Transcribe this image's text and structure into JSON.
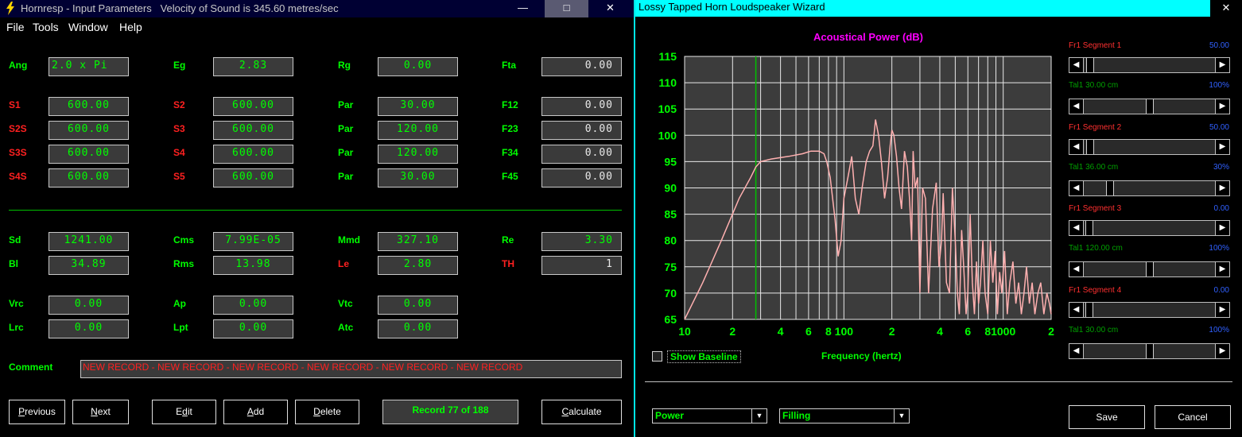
{
  "left_window": {
    "title": "Hornresp - Input Parameters   Velocity of Sound is 345.60 metres/sec",
    "controls": {
      "minimize": "—",
      "maximize": "□",
      "close": "✕"
    },
    "menu": [
      "File",
      "Tools",
      "Window",
      "Help"
    ],
    "params": {
      "Ang": "2.0 x Pi",
      "Eg": "2.83",
      "Rg": "0.00",
      "Fta": "0.00",
      "S1": "600.00",
      "S2": "600.00",
      "Par1": "30.00",
      "F12": "0.00",
      "S2S": "600.00",
      "S3": "600.00",
      "Par2": "120.00",
      "F23": "0.00",
      "S3S": "600.00",
      "S4": "600.00",
      "Par3": "120.00",
      "F34": "0.00",
      "S4S": "600.00",
      "S5": "600.00",
      "Par4": "30.00",
      "F45": "0.00",
      "Sd": "1241.00",
      "Cms": "7.99E-05",
      "Mmd": "327.10",
      "Re": "3.30",
      "Bl": "34.89",
      "Rms": "13.98",
      "Le": "2.80",
      "TH": "1",
      "Vrc": "0.00",
      "Ap": "0.00",
      "Vtc": "0.00",
      "Lrc": "0.00",
      "Lpt": "0.00",
      "Atc": "0.00"
    },
    "labels": {
      "Ang": "Ang",
      "Eg": "Eg",
      "Rg": "Rg",
      "Fta": "Fta",
      "S1": "S1",
      "S2": "S2",
      "Par": "Par",
      "F12": "F12",
      "S2S": "S2S",
      "S3": "S3",
      "F23": "F23",
      "S3S": "S3S",
      "S4": "S4",
      "F34": "F34",
      "S4S": "S4S",
      "S5": "S5",
      "F45": "F45",
      "Sd": "Sd",
      "Cms": "Cms",
      "Mmd": "Mmd",
      "Re": "Re",
      "Bl": "Bl",
      "Rms": "Rms",
      "Le": "Le",
      "TH": "TH",
      "Vrc": "Vrc",
      "Ap": "Ap",
      "Vtc": "Vtc",
      "Lrc": "Lrc",
      "Lpt": "Lpt",
      "Atc": "Atc",
      "Comment": "Comment"
    },
    "comment": "NEW RECORD - NEW RECORD - NEW RECORD - NEW RECORD - NEW RECORD - NEW RECORD",
    "buttons": {
      "previous_u": "P",
      "previous_rest": "revious",
      "next_u": "N",
      "next_rest": "ext",
      "edit_a": "E",
      "edit_u": "d",
      "edit_rest": "it",
      "add_u": "A",
      "add_rest": "dd",
      "delete_u": "D",
      "delete_rest": "elete",
      "calculate_u": "C",
      "calculate_rest": "alculate"
    },
    "record": "Record 77 of 188"
  },
  "right_window": {
    "title": "Lossy Tapped Horn Loudspeaker Wizard",
    "close": "✕",
    "segments": [
      {
        "name_a": "Fr1",
        "name_b": "Segment 1",
        "value": "50.00",
        "tal": "Tal1",
        "tal_value": "30.00 cm",
        "tal_pct": "100%",
        "value_color": "#3060ff",
        "pct_color": "#3060ff"
      },
      {
        "name_a": "Fr1",
        "name_b": "Segment 2",
        "value": "50.00",
        "tal": "Tal1",
        "tal_value": "36.00 cm",
        "tal_pct": "30%",
        "value_color": "#3060ff",
        "pct_color": "#3060ff"
      },
      {
        "name_a": "Fr1",
        "name_b": "Segment 3",
        "value": "0.00",
        "tal": "Tal1",
        "tal_value": "120.00 cm",
        "tal_pct": "100%",
        "value_color": "#3060ff",
        "pct_color": "#3060ff"
      },
      {
        "name_a": "Fr1",
        "name_b": "Segment 4",
        "value": "0.00",
        "tal": "Tal1",
        "tal_value": "30.00 cm",
        "tal_pct": "100%",
        "value_color": "#3060ff",
        "pct_color": "#3060ff"
      }
    ],
    "sliders": [
      0.02,
      0.5,
      0.02,
      0.18,
      0.01,
      0.5,
      0.01,
      0.5
    ],
    "show_baseline": "Show Baseline",
    "xlabel": "Frequency (hertz)",
    "select_power": "Power",
    "select_filling": "Filling",
    "save": "Save",
    "cancel": "Cancel"
  },
  "chart_data": {
    "type": "line",
    "title": "Acoustical Power (dB)",
    "xlabel": "Frequency (hertz)",
    "ylabel": "",
    "x_scale": "log",
    "xlim": [
      10,
      2000
    ],
    "ylim": [
      65,
      115
    ],
    "x_tick_labels": [
      "10",
      "2",
      "4",
      "6",
      "8",
      "100",
      "2",
      "4",
      "6",
      "8",
      "1000",
      "2"
    ],
    "y_tick_labels": [
      "115",
      "110",
      "105",
      "100",
      "95",
      "90",
      "85",
      "80",
      "75",
      "70",
      "65"
    ],
    "marker_x": 28,
    "grid": true,
    "colors": {
      "title": "#ff00ff",
      "line": "#ffb0b0",
      "marker": "#00c000",
      "grid": "#e8e8e8",
      "plot_bg": "#3c3c3c"
    },
    "series": [
      {
        "x": [
          10,
          13,
          17,
          22,
          26,
          28,
          30,
          35,
          45,
          55,
          62,
          70,
          75,
          78,
          82,
          88,
          92,
          96,
          100,
          106,
          112,
          118,
          124,
          130,
          138,
          145,
          152,
          158,
          165,
          172,
          180,
          188,
          195,
          200,
          206,
          214,
          222,
          230,
          240,
          250,
          258,
          266,
          272,
          280,
          290,
          300,
          312,
          325,
          340,
          360,
          380,
          395,
          410,
          420,
          440,
          460,
          480,
          500,
          515,
          530,
          548,
          565,
          585,
          600,
          620,
          640,
          660,
          680,
          700,
          720,
          745,
          770,
          800,
          830,
          860,
          890,
          920,
          950,
          980,
          1020,
          1060,
          1100,
          1150,
          1200,
          1250,
          1300,
          1350,
          1400,
          1460,
          1520,
          1580,
          1650,
          1720,
          1800,
          1880,
          1950,
          2000
        ],
        "y": [
          65,
          72,
          80,
          88,
          92,
          94,
          95,
          95.5,
          96,
          96.5,
          97,
          97,
          96.5,
          95,
          92,
          84,
          77,
          80,
          88,
          92,
          96,
          88,
          85,
          90,
          95,
          97,
          98,
          103,
          100,
          95,
          88,
          92,
          98,
          101,
          100,
          96,
          90,
          86,
          97,
          94,
          88,
          80,
          97,
          90,
          92,
          70,
          90,
          88,
          70,
          86,
          91,
          75,
          80,
          89,
          72,
          70,
          90,
          80,
          70,
          66,
          82,
          75,
          66,
          70,
          85,
          72,
          66,
          76,
          68,
          72,
          80,
          70,
          66,
          80,
          72,
          78,
          66,
          74,
          70,
          78,
          66,
          72,
          76,
          68,
          72,
          66,
          70,
          75,
          68,
          72,
          66,
          70,
          72,
          66,
          70,
          68,
          66
        ]
      }
    ]
  }
}
